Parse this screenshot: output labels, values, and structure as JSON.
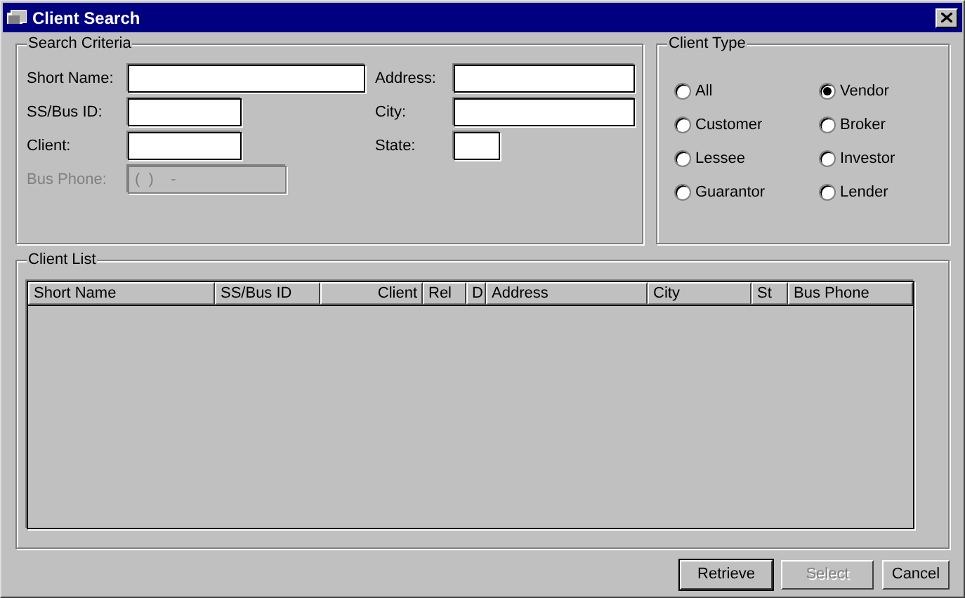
{
  "window": {
    "title": "Client Search"
  },
  "search_criteria": {
    "title": "Search Criteria",
    "left_fields": [
      {
        "label": "Short Name:",
        "kind": "long",
        "disabled": false
      },
      {
        "label": "SS/Bus ID:",
        "kind": "short",
        "disabled": false
      },
      {
        "label": "Client:",
        "kind": "short",
        "disabled": false
      },
      {
        "label": "Bus Phone:",
        "kind": "phone",
        "disabled": true,
        "value": "(  )    -"
      }
    ],
    "right_fields": [
      {
        "label": "Address:",
        "kind": "medium",
        "disabled": false
      },
      {
        "label": "City:",
        "kind": "medium",
        "disabled": false
      },
      {
        "label": "State:",
        "kind": "tiny",
        "disabled": false
      }
    ]
  },
  "client_type": {
    "title": "Client Type",
    "options": [
      {
        "label": "All",
        "selected": false
      },
      {
        "label": "Vendor",
        "selected": true
      },
      {
        "label": "Customer",
        "selected": false
      },
      {
        "label": "Broker",
        "selected": false
      },
      {
        "label": "Lessee",
        "selected": false
      },
      {
        "label": "Investor",
        "selected": false
      },
      {
        "label": "Guarantor",
        "selected": false
      },
      {
        "label": "Lender",
        "selected": false
      }
    ]
  },
  "client_list": {
    "title": "Client List",
    "columns": [
      {
        "label": "Short Name"
      },
      {
        "label": "SS/Bus ID"
      },
      {
        "label": "Client"
      },
      {
        "label": "Rel"
      },
      {
        "label": "D"
      },
      {
        "label": "Address"
      },
      {
        "label": "City"
      },
      {
        "label": "St"
      },
      {
        "label": "Bus Phone"
      }
    ]
  },
  "buttons": [
    {
      "label": "Retrieve",
      "disabled": false,
      "default": true
    },
    {
      "label": "Select",
      "disabled": true,
      "default": false
    },
    {
      "label": "Cancel",
      "disabled": false,
      "default": false
    }
  ]
}
